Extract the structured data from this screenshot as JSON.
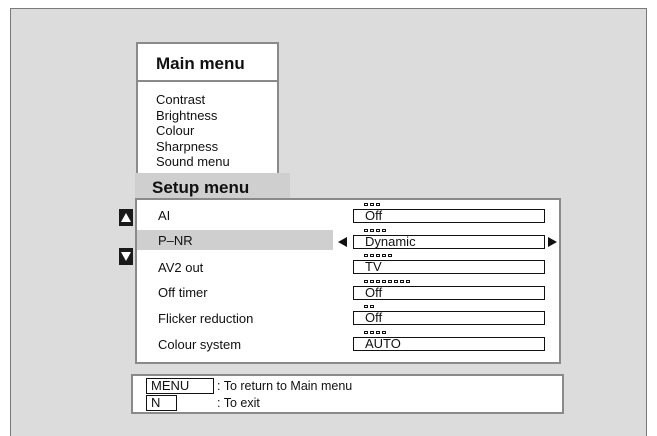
{
  "main_menu": {
    "title": "Main menu",
    "items": [
      "Contrast",
      "Brightness",
      "Colour",
      "Sharpness",
      "Sound menu"
    ]
  },
  "setup_menu": {
    "title": "Setup menu",
    "items": [
      {
        "label": "AI",
        "value": "Off",
        "squares": 3
      },
      {
        "label": "P–NR",
        "value": "Dynamic",
        "squares": 4
      },
      {
        "label": "AV2 out",
        "value": "TV",
        "squares": 5
      },
      {
        "label": "Off timer",
        "value": "Off",
        "squares": 8
      },
      {
        "label": "Flicker reduction",
        "value": "Off",
        "squares": 2
      },
      {
        "label": "Colour system",
        "value": "AUTO",
        "squares": 4
      }
    ],
    "selected_index": 1
  },
  "help": {
    "menu_key": "MENU",
    "menu_text": ": To return to Main menu",
    "exit_key": "N",
    "exit_text": ": To exit"
  },
  "colors": {
    "screen_bg": "#dcdcdc",
    "highlight": "#cfcfcf",
    "border": "#8a8a8a"
  },
  "icons": {
    "up": "triangle-up-icon",
    "down": "triangle-down-icon",
    "left": "triangle-left-icon",
    "right": "triangle-right-icon"
  }
}
